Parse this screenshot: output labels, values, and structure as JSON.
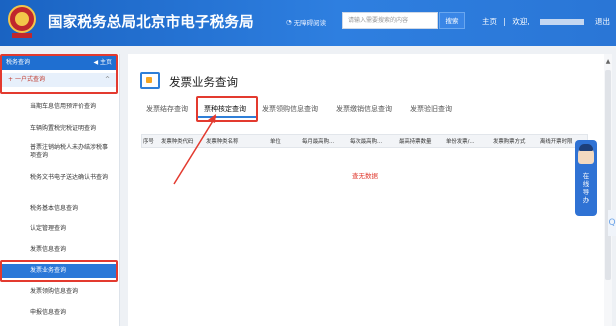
{
  "header": {
    "site_title": "国家税务总局北京市电子税务局",
    "accessibility": "无障碍阅读",
    "search_placeholder": "请输入需要搜索的内容",
    "search_button": "搜索",
    "home_link": "主页",
    "separator": "|",
    "welcome": "欢迎,",
    "logout": "退出",
    "colors": {
      "header_blue": "#1a63c2",
      "accent": "#e33a2f"
    }
  },
  "sidebar": {
    "section_title": "税务查询",
    "home_label": "主页",
    "group_label": "一户式查询",
    "items": [
      "当期车息信用预评价查询",
      "车辆购置税完税证明查询",
      "普票注销纳税人未办结涉税事项查询",
      "税务文书电子送达确认书查询",
      "税务基本信息查询",
      "认定管理查询",
      "发票信息查询",
      "发票业务查询",
      "发票领购信息查询",
      "申报信息查询"
    ],
    "active_index": 7
  },
  "main": {
    "page_title": "发票业务查询",
    "tabs": [
      "发票结存查询",
      "票种核定查询",
      "发票领购信息查询",
      "发票缴销信息查询",
      "发票验旧查询"
    ],
    "active_tab": 1,
    "table_headers": [
      "序号",
      "发票种类代码",
      "发票种类名称",
      "单位",
      "每月最高购...",
      "每次最高购...",
      "最高持票数量",
      "单份发票/...",
      "发票购票方式",
      "离线开票时限"
    ],
    "empty_text": "查无数据"
  },
  "float_guide": {
    "text": "在线导办"
  },
  "edge_glyph": "Q"
}
